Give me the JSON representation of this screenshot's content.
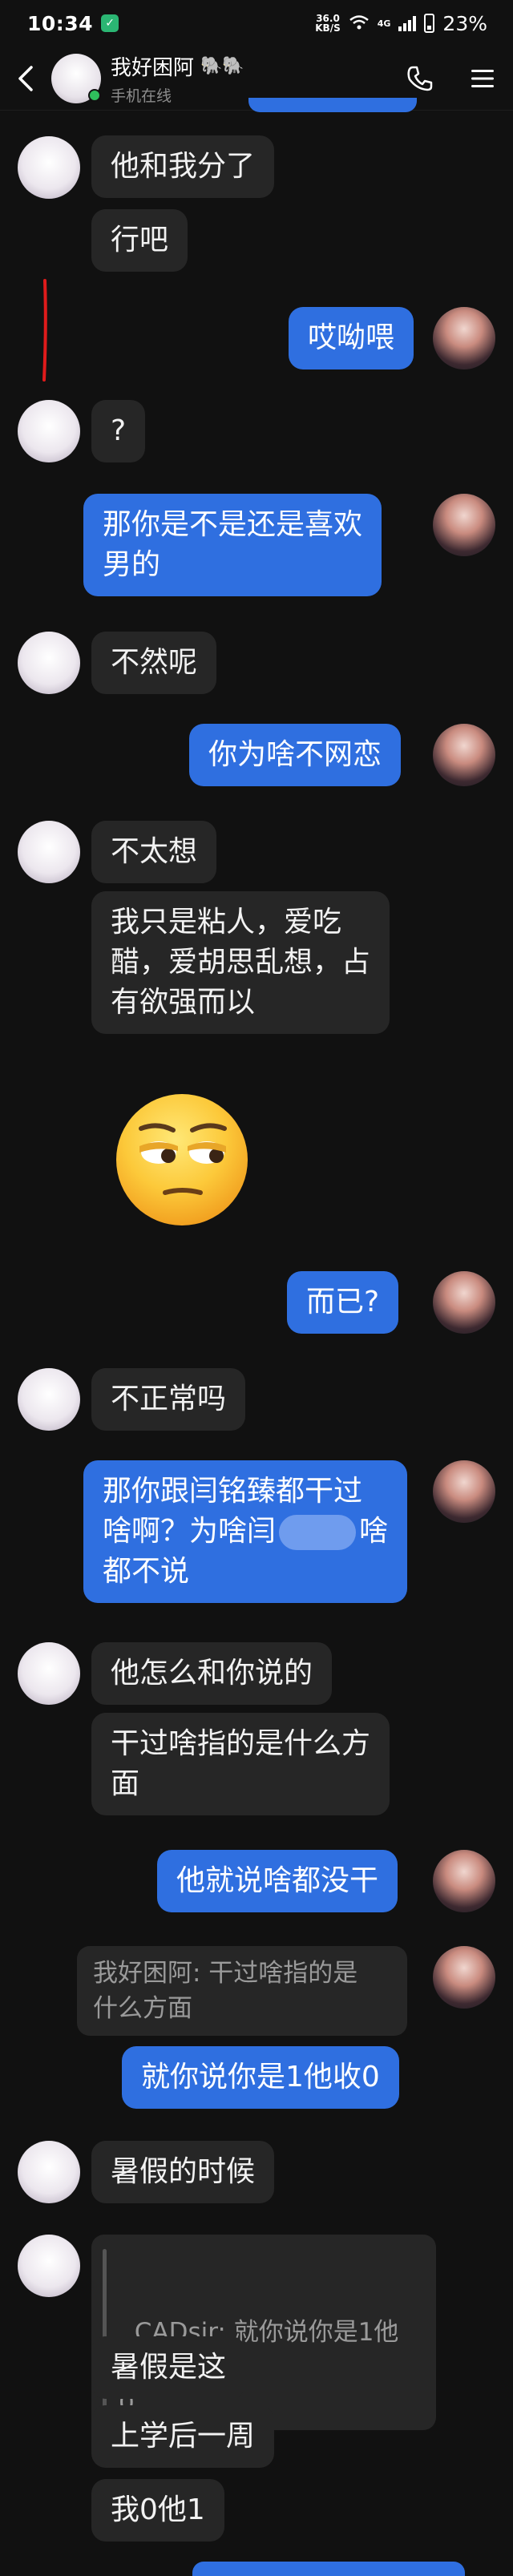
{
  "status_bar": {
    "time": "10:34",
    "speed_value": "36.0",
    "speed_unit": "KB/S",
    "network": "4G",
    "battery": "23%"
  },
  "header": {
    "name": "我好困阿",
    "name_emoji": "🐘🐘",
    "status": "手机在线"
  },
  "messages": [
    {
      "side": "in",
      "text": "他和我分了"
    },
    {
      "side": "in",
      "text": "行吧"
    },
    {
      "side": "out",
      "text": "哎呦喂"
    },
    {
      "side": "in",
      "text": "?"
    },
    {
      "side": "out",
      "text": "那你是不是还是喜欢\n男的"
    },
    {
      "side": "in",
      "text": "不然呢"
    },
    {
      "side": "out",
      "text": "你为啥不网恋"
    },
    {
      "side": "in",
      "text": "不太想"
    },
    {
      "side": "in",
      "text": "我只是粘人，爱吃\n醋，爱胡思乱想，占\n有欲强而以"
    },
    {
      "side": "in",
      "sticker": "unamused-face-sticker"
    },
    {
      "side": "out",
      "text": "而已?"
    },
    {
      "side": "in",
      "text": "不正常吗"
    },
    {
      "side": "out",
      "text_a": "那你跟闫铭臻都干过\n啥啊？为啥闫",
      "text_b": "啥\n都不说"
    },
    {
      "side": "in",
      "text": "他怎么和你说的"
    },
    {
      "side": "in",
      "text": "干过啥指的是什么方\n面"
    },
    {
      "side": "out",
      "text": "他就说啥都没干"
    },
    {
      "side": "out",
      "quote": "我好困阿: 干过啥指的是\n什么方面",
      "text": "就你说你是1他收0"
    },
    {
      "side": "in",
      "text": "暑假的时候"
    },
    {
      "side": "in",
      "quote": "CADsir: 就你说你是1他收\n0"
    },
    {
      "side": "in",
      "text": "暑假是这"
    },
    {
      "side": "in",
      "text": "上学后一周"
    },
    {
      "side": "in",
      "text": "我0他1"
    }
  ],
  "colors": {
    "background": "#111111",
    "bubble_in": "#262626",
    "bubble_out": "#2f6fe0",
    "annotation": "#e01b1b"
  }
}
